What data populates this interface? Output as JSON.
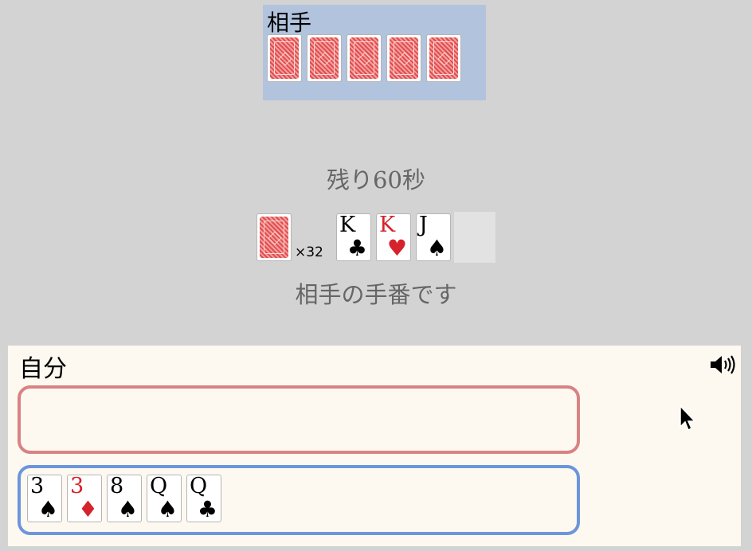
{
  "opponent": {
    "label": "相手",
    "hand": [
      "back",
      "back",
      "back",
      "back",
      "back"
    ]
  },
  "status": {
    "timer": "残り60秒",
    "turn": "相手の手番です"
  },
  "deck": {
    "count_label": "×32"
  },
  "field": {
    "cards": [
      {
        "rank": "K",
        "suit": "♣",
        "color": "black"
      },
      {
        "rank": "K",
        "suit": "♥",
        "color": "red"
      },
      {
        "rank": "J",
        "suit": "♠",
        "color": "black"
      }
    ]
  },
  "self": {
    "label": "自分",
    "sound_icon": "speaker-volume-icon",
    "hand": [
      {
        "rank": "3",
        "suit": "♠",
        "color": "black"
      },
      {
        "rank": "3",
        "suit": "♦",
        "color": "red"
      },
      {
        "rank": "8",
        "suit": "♠",
        "color": "black"
      },
      {
        "rank": "Q",
        "suit": "♠",
        "color": "black"
      },
      {
        "rank": "Q",
        "suit": "♣",
        "color": "black"
      }
    ]
  }
}
